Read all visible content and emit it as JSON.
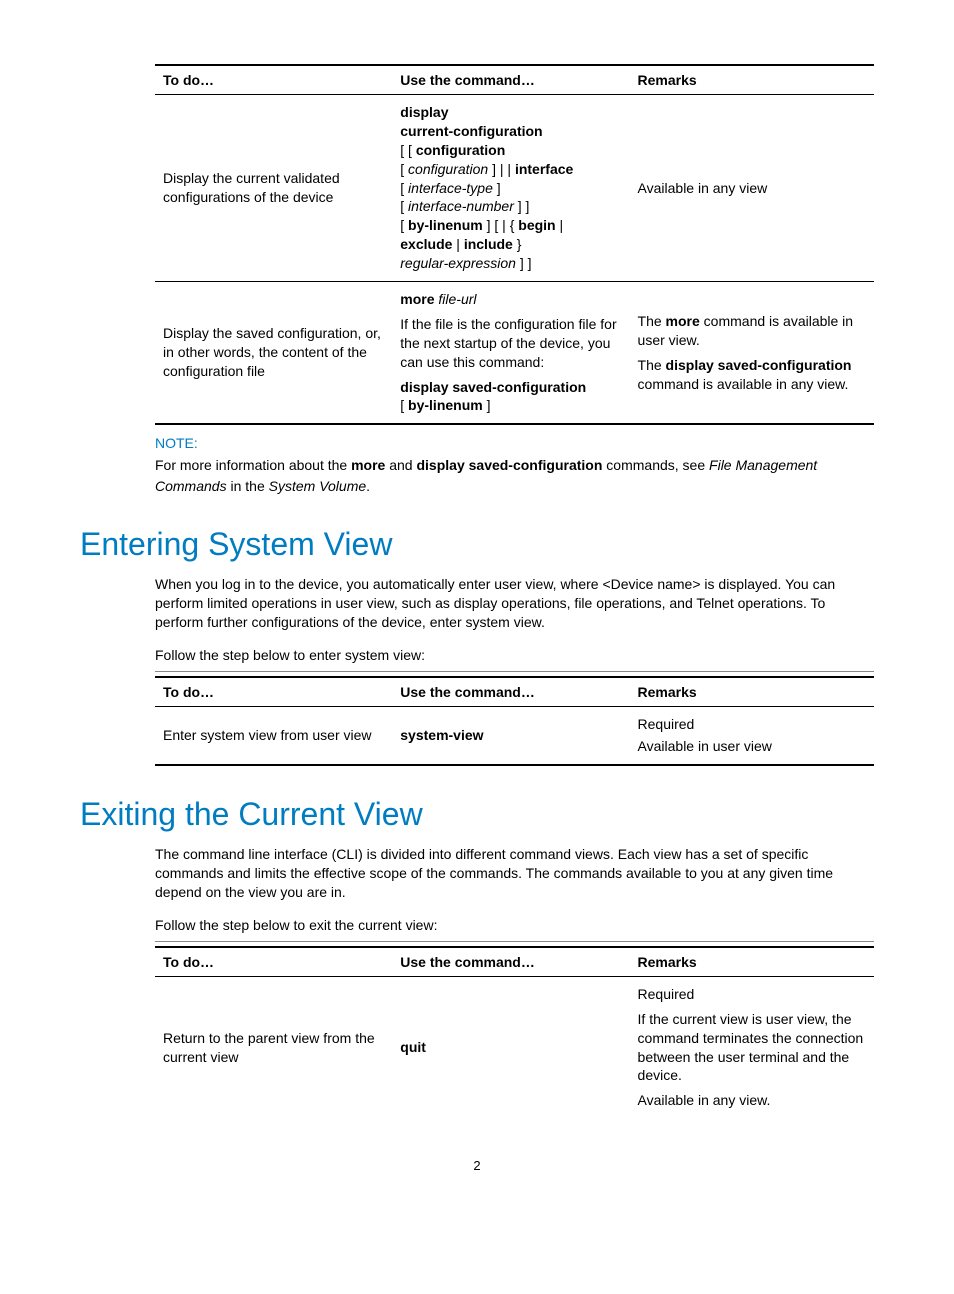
{
  "table1": {
    "headers": {
      "todo": "To do…",
      "cmd": "Use the command…",
      "remarks": "Remarks"
    },
    "row1": {
      "todo": "Display the current validated configurations of the device",
      "cmd_l1a": "display",
      "cmd_l1b": "current-configuration",
      "cmd_l2a": "[ [ ",
      "cmd_l2b": "configuration",
      "cmd_l3a": "[ ",
      "cmd_l3b": "configuration",
      "cmd_l3c": " ] | | ",
      "cmd_l3d": "interface",
      "cmd_l4a": "[ ",
      "cmd_l4b": "interface-type",
      "cmd_l4c": " ]",
      "cmd_l5a": "[ ",
      "cmd_l5b": "interface-number",
      "cmd_l5c": " ] ]",
      "cmd_l6a": "[ ",
      "cmd_l6b": "by-linenum",
      "cmd_l6c": " ] [ | { ",
      "cmd_l6d": "begin",
      "cmd_l6e": " |",
      "cmd_l7a": "exclude",
      "cmd_l7b": " | ",
      "cmd_l7c": "include",
      "cmd_l7d": " }",
      "cmd_l8a": "regular-expression",
      "cmd_l8b": " ] ]",
      "remarks": "Available in any view"
    },
    "row2": {
      "todo": "Display the saved configuration, or, in other words, the content of the configuration file",
      "c1a": "more",
      "c1b": " file-url",
      "c2": "If the file is the configuration file for the next startup of the device, you can use this command:",
      "c3a": "display saved-configuration",
      "c3b": "[ ",
      "c3c": "by-linenum",
      "c3d": " ]",
      "r1a": "The ",
      "r1b": "more",
      "r1c": " command is available in user view.",
      "r2a": "The ",
      "r2b": "display saved-configuration",
      "r2c": " command is available in any view."
    }
  },
  "note": {
    "label": "NOTE:",
    "p1": "For more information about the ",
    "b1": "more",
    "p2": " and ",
    "b2": "display saved-configuration",
    "p3": " commands, see ",
    "i1": "File Management Commands",
    "p4": " in the ",
    "i2": "System Volume",
    "p5": "."
  },
  "section1": {
    "heading": "Entering System View",
    "para": "When you log in to the device, you automatically enter user view, where <Device name> is displayed. You can perform limited operations in user view, such as display operations, file operations, and Telnet operations. To perform further configurations of the device, enter system view.",
    "lead": "Follow the step below to enter system view:"
  },
  "table2": {
    "headers": {
      "todo": "To do…",
      "cmd": "Use the command…",
      "remarks": "Remarks"
    },
    "row1": {
      "todo": "Enter system view from user view",
      "cmd": "system-view",
      "r1": "Required",
      "r2": "Available in user view"
    }
  },
  "section2": {
    "heading": "Exiting the Current View",
    "para": "The command line interface (CLI) is divided into different command views. Each view has a set of specific commands and limits the effective scope of the commands. The commands available to you at any given time depend on the view you are in.",
    "lead": "Follow the step below to exit the current view:"
  },
  "table3": {
    "headers": {
      "todo": "To do…",
      "cmd": "Use the command…",
      "remarks": "Remarks"
    },
    "row1": {
      "todo": "Return to the parent view from the current view",
      "cmd": "quit",
      "r1": "Required",
      "r2": "If the current view is user view, the command terminates the connection between the user terminal and the device.",
      "r3": "Available in any view."
    }
  },
  "pagenum": "2"
}
